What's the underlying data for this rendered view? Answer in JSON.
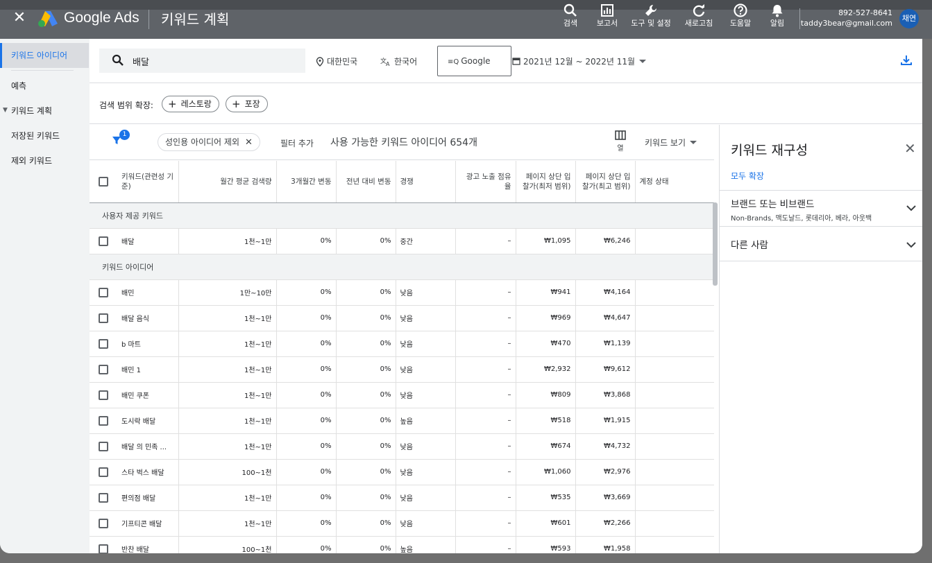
{
  "app": {
    "brand": "Google Ads",
    "page_title": "키워드 계획",
    "close_icon": "close-icon"
  },
  "toolbar": {
    "items": [
      {
        "label": "검색",
        "icon": "search-icon"
      },
      {
        "label": "보고서",
        "icon": "reports-icon"
      },
      {
        "label": "도구 및 설정",
        "icon": "wrench-icon"
      },
      {
        "label": "새로고침",
        "icon": "refresh-icon"
      },
      {
        "label": "도움말",
        "icon": "help-icon"
      },
      {
        "label": "알림",
        "icon": "bell-icon"
      }
    ],
    "account_id": "892-527-8641",
    "account_email": "taddy3bear@gmail.com",
    "avatar_text": "채연"
  },
  "sidebar": {
    "items": [
      {
        "label": "키워드 아이디어",
        "active": true
      },
      {
        "label": "예측"
      },
      {
        "label": "키워드 계획"
      },
      {
        "label": "저장된 키워드"
      },
      {
        "label": "제외 키워드"
      }
    ]
  },
  "search": {
    "keyword": "배달",
    "location": "대한민국",
    "language": "한국어",
    "network": "Google",
    "date_range": "2021년 12월 ~ 2022년 11월"
  },
  "expand": {
    "label": "검색 범위 확장:",
    "pills": [
      "레스토랑",
      "포장"
    ]
  },
  "filters": {
    "badge_count": "1",
    "active_filter": "성인용 아이디어 제외",
    "add_filter": "필터 추가",
    "available_summary": "사용 가능한 키워드 아이디어 654개",
    "columns_label": "열",
    "view_label": "키워드 보기"
  },
  "table": {
    "headers": [
      "키워드(관련성 기준)",
      "월간 평균 검색량",
      "3개월간 변동",
      "전년 대비 변동",
      "경쟁",
      "광고 노출 점유율",
      "페이지 상단 입찰가(최저 범위)",
      "페이지 상단 입찰가(최고 범위)",
      "계정 상태"
    ],
    "group_user": "사용자 제공 키워드",
    "user_rows": [
      [
        "배달",
        "1천~1만",
        "0%",
        "0%",
        "중간",
        "–",
        "₩1,095",
        "₩6,246"
      ]
    ],
    "group_ideas": "키워드 아이디어",
    "idea_rows": [
      [
        "배민",
        "1만~10만",
        "0%",
        "0%",
        "낮음",
        "–",
        "₩941",
        "₩4,164"
      ],
      [
        "배달 음식",
        "1천~1만",
        "0%",
        "0%",
        "낮음",
        "–",
        "₩969",
        "₩4,647"
      ],
      [
        "b 마트",
        "1천~1만",
        "0%",
        "0%",
        "낮음",
        "–",
        "₩470",
        "₩1,139"
      ],
      [
        "배민 1",
        "1천~1만",
        "0%",
        "0%",
        "낮음",
        "–",
        "₩2,932",
        "₩9,612"
      ],
      [
        "배민 쿠폰",
        "1천~1만",
        "0%",
        "0%",
        "낮음",
        "–",
        "₩809",
        "₩3,868"
      ],
      [
        "도시락 배달",
        "1천~1만",
        "0%",
        "0%",
        "높음",
        "–",
        "₩518",
        "₩1,915"
      ],
      [
        "배달 의 민족 ...",
        "1천~1만",
        "0%",
        "0%",
        "낮음",
        "–",
        "₩674",
        "₩4,732"
      ],
      [
        "스타 벅스 배달",
        "100~1천",
        "0%",
        "0%",
        "낮음",
        "–",
        "₩1,060",
        "₩2,976"
      ],
      [
        "편의점 배달",
        "1천~1만",
        "0%",
        "0%",
        "낮음",
        "–",
        "₩535",
        "₩3,669"
      ],
      [
        "기프티콘 배달",
        "1천~1만",
        "0%",
        "0%",
        "낮음",
        "–",
        "₩601",
        "₩2,266"
      ],
      [
        "반찬 배달",
        "100~1천",
        "0%",
        "0%",
        "높음",
        "–",
        "₩593",
        "₩1,958"
      ]
    ]
  },
  "refine": {
    "title": "키워드 재구성",
    "expand_all": "모두 확장",
    "sections": [
      {
        "title": "브랜드 또는 비브랜드",
        "subtitle": "Non-Brands, 맥도날드, 롯데리아, 베라, 아웃백"
      },
      {
        "title": "다른 사람",
        "subtitle": ""
      }
    ]
  },
  "colors": {
    "accent": "#1a73e8",
    "appbar": "#5f6368"
  }
}
